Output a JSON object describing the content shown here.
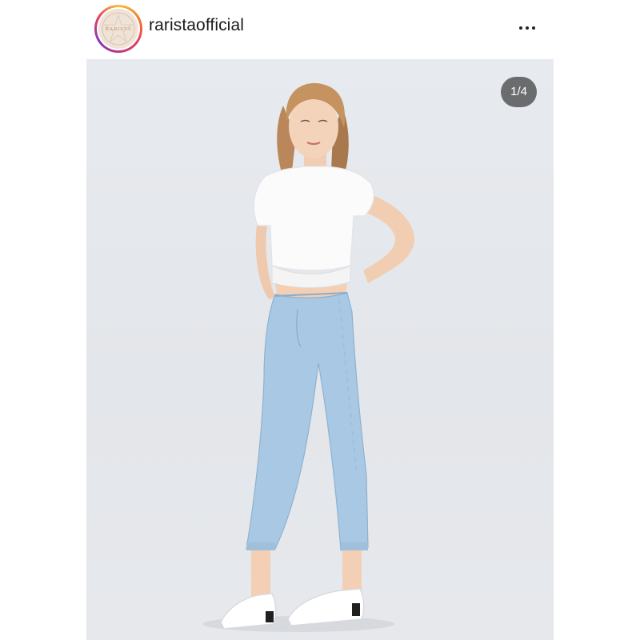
{
  "post": {
    "username": "raristaofficial",
    "avatar_text": "RARISTA",
    "image_counter": "1/4"
  },
  "icons": {
    "more": "more-horizontal-icon"
  },
  "colors": {
    "story_ring": [
      "#f9c23c",
      "#e4405f",
      "#833ab4"
    ],
    "photo_background": "#e5e8ec",
    "denim": "#a9c8e3",
    "tshirt": "#ffffff"
  }
}
